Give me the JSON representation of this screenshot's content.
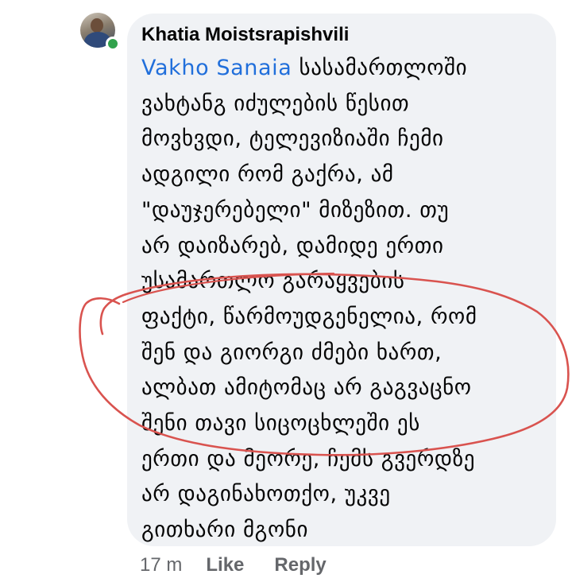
{
  "comment": {
    "author": "Khatia Moistsrapishvili",
    "mention": "Vakho Sanaia",
    "lines": [
      " სასამართლოში",
      "ვახტანგ იძულების წესით",
      "მოვხვდი, ტელევიზიაში ჩემი",
      "ადგილი რომ გაქრა, ამ",
      "\"დაუჯერებელი\" მიზეზით. თუ",
      "არ დაიზარებ, დამიდე ერთი",
      "უსამართლო გარაყვების",
      "ფაქტი, წარმოუდგენელია, რომ",
      "შენ და გიორგი ძმები ხართ,",
      "ალბათ ამიტომაც არ გაგვაცნო",
      "შენი თავი სიცოცხლეში ეს",
      "ერთი და მეორე, ჩემს გვერდზე",
      "არ დაგინახოთქო, უკვე",
      "გითხარი მგონი"
    ]
  },
  "actions": {
    "time": "17 m",
    "like_label": "Like",
    "reply_label": "Reply"
  },
  "colors": {
    "bubble": "#f0f2f5",
    "mention": "#216fdb",
    "meta": "#65676b",
    "online": "#31a24c",
    "annotation": "#d9534f"
  },
  "icons": {
    "avatar": "profile-photo",
    "online_indicator": "green-dot"
  }
}
